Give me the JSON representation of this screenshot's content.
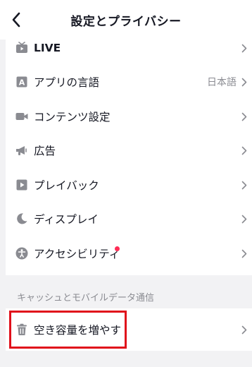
{
  "header": {
    "title": "設定とプライバシー"
  },
  "items": [
    {
      "label": "LIVE",
      "icon": "live-tv-icon"
    },
    {
      "label": "アプリの言語",
      "value": "日本語",
      "icon": "language-a-icon"
    },
    {
      "label": "コンテンツ設定",
      "icon": "video-camera-icon"
    },
    {
      "label": "広告",
      "icon": "megaphone-icon"
    },
    {
      "label": "プレイバック",
      "icon": "play-icon"
    },
    {
      "label": "ディスプレイ",
      "icon": "moon-icon"
    },
    {
      "label": "アクセシビリティ",
      "icon": "accessibility-icon",
      "badge": "red-dot"
    }
  ],
  "section": {
    "title": "キャッシュとモバイルデータ通信"
  },
  "storage": {
    "label": "空き容量を増やす",
    "icon": "trash-icon"
  },
  "colors": {
    "accent": "#fe2c55",
    "highlight": "#e0101b",
    "icon": "#8a8b91"
  }
}
